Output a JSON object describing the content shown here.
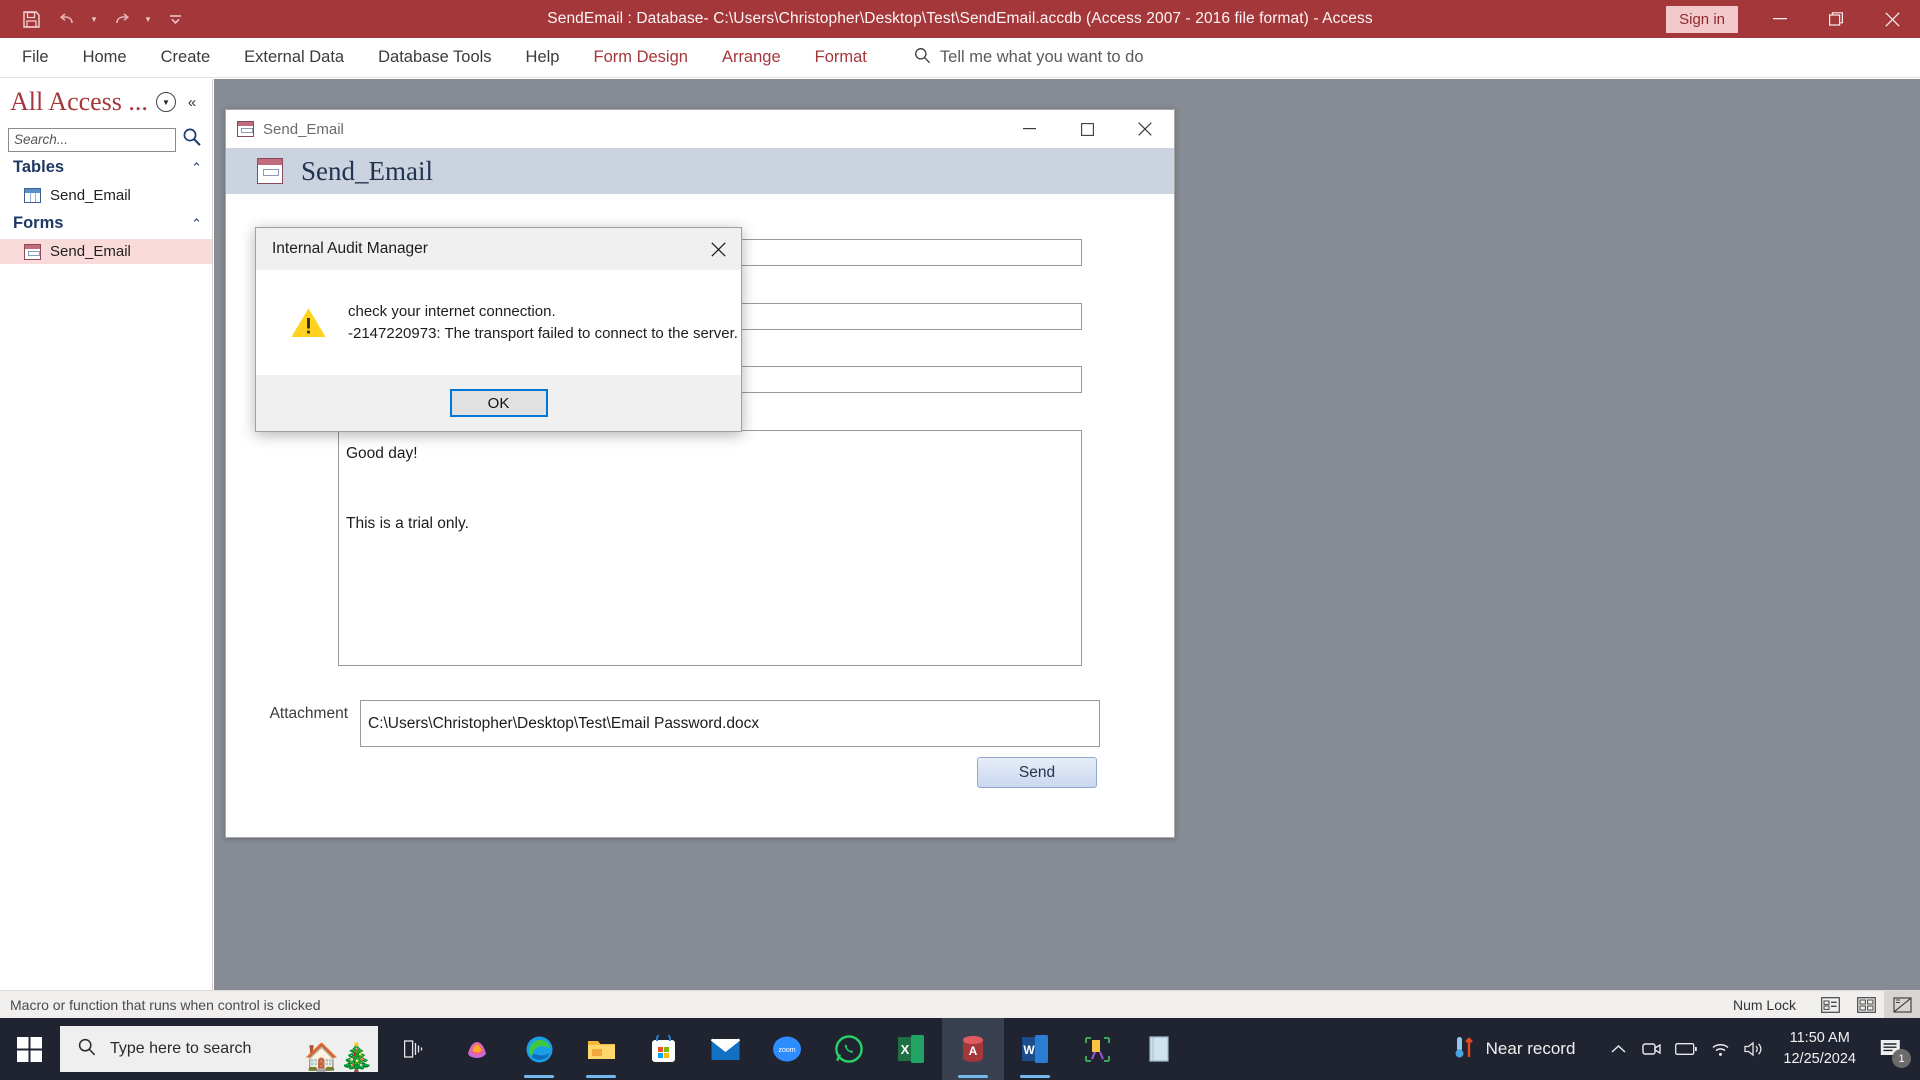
{
  "titlebar": {
    "title": "SendEmail : Database- C:\\Users\\Christopher\\Desktop\\Test\\SendEmail.accdb (Access 2007 - 2016 file format)  -  Access",
    "signin_label": "Sign in",
    "qat": [
      {
        "name": "save-icon",
        "label": "Save"
      },
      {
        "name": "undo-icon",
        "label": "Undo"
      },
      {
        "name": "redo-icon",
        "label": "Redo"
      },
      {
        "name": "customize-qat-icon",
        "label": "Customize Quick Access Toolbar"
      }
    ],
    "window_buttons": [
      "minimize",
      "restore",
      "close"
    ]
  },
  "ribbon": {
    "tabs": [
      {
        "label": "File",
        "contextual": false
      },
      {
        "label": "Home",
        "contextual": false
      },
      {
        "label": "Create",
        "contextual": false
      },
      {
        "label": "External Data",
        "contextual": false
      },
      {
        "label": "Database Tools",
        "contextual": false
      },
      {
        "label": "Help",
        "contextual": false
      },
      {
        "label": "Form Design",
        "contextual": true
      },
      {
        "label": "Arrange",
        "contextual": true
      },
      {
        "label": "Format",
        "contextual": true
      }
    ],
    "tellme_placeholder": "Tell me what you want to do"
  },
  "navpane": {
    "title": "All Access ...",
    "search_placeholder": "Search...",
    "groups": [
      {
        "label": "Tables",
        "items": [
          {
            "label": "Send_Email",
            "icon": "table-icon",
            "selected": false
          }
        ]
      },
      {
        "label": "Forms",
        "items": [
          {
            "label": "Send_Email",
            "icon": "form-icon",
            "selected": true
          }
        ]
      }
    ]
  },
  "form_window": {
    "titlebar_text": "Send_Email",
    "header_title": "Send_Email",
    "fields": [
      {
        "label": "",
        "value": "",
        "name": "to-field"
      },
      {
        "label": "",
        "value": "",
        "name": "cc-field"
      },
      {
        "label": "",
        "value": "",
        "name": "bcc-field"
      },
      {
        "label": "",
        "value": "",
        "name": "subject-field"
      }
    ],
    "message_label": "",
    "message_value": "Good day!\n\nThis is a trial only.",
    "attachment_label": "Attachment",
    "attachment_value": "C:\\Users\\Christopher\\Desktop\\Test\\Email Password.docx",
    "send_label": "Send"
  },
  "dialog": {
    "title": "Internal Audit Manager",
    "message_line1": "check your internet connection.",
    "message_line2": "-2147220973: The transport failed to connect to the server.",
    "ok_label": "OK",
    "icon": "warning-icon",
    "warning_color": "#ffd21f"
  },
  "statusbar": {
    "message": "Macro or function that runs when control is clicked",
    "num_lock": "Num Lock",
    "view_buttons": [
      {
        "name": "form-view-button",
        "active": false
      },
      {
        "name": "layout-view-button",
        "active": false
      },
      {
        "name": "design-view-button",
        "active": true
      }
    ]
  },
  "taskbar": {
    "search_placeholder": "Type here to search",
    "apps": [
      {
        "name": "taskview-icon",
        "label": "Task View"
      },
      {
        "name": "copilot-icon",
        "label": "Copilot"
      },
      {
        "name": "edge-icon",
        "label": "Microsoft Edge"
      },
      {
        "name": "file-explorer-icon",
        "label": "File Explorer"
      },
      {
        "name": "microsoft-store-icon",
        "label": "Microsoft Store"
      },
      {
        "name": "mail-icon",
        "label": "Mail"
      },
      {
        "name": "zoom-icon",
        "label": "Zoom"
      },
      {
        "name": "whatsapp-icon",
        "label": "WhatsApp"
      },
      {
        "name": "excel-icon",
        "label": "Excel"
      },
      {
        "name": "access-icon",
        "label": "Access"
      },
      {
        "name": "word-icon",
        "label": "Word"
      },
      {
        "name": "snipping-tool-icon",
        "label": "Snipping Tool"
      },
      {
        "name": "notes-icon",
        "label": "Sticky Notes"
      }
    ],
    "weather": "Near record",
    "time": "11:50 AM",
    "date": "12/25/2024",
    "notification_count": "1"
  }
}
